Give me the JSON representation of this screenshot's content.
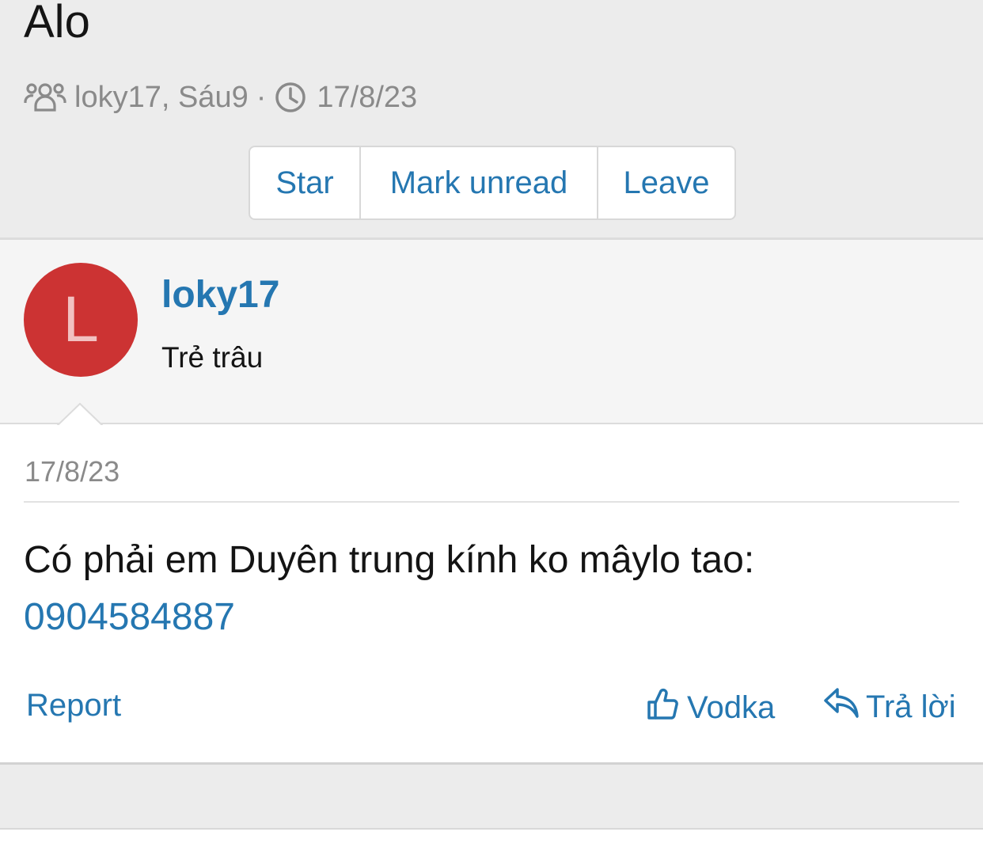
{
  "conversation": {
    "title": "Alo",
    "participants": "loky17, Sáu9",
    "separator": "·",
    "date": "17/8/23"
  },
  "actions": {
    "star_label": "Star",
    "mark_unread_label": "Mark unread",
    "leave_label": "Leave"
  },
  "message": {
    "author": {
      "avatar_letter": "L",
      "avatar_color": "#cc3333",
      "username": "loky17",
      "user_title": "Trẻ trâu"
    },
    "date": "17/8/23",
    "body_text": "Có phải em Duyên trung kính ko mâylo tao:",
    "phone_link": "0904584887",
    "footer": {
      "report_label": "Report",
      "like_label": "Vodka",
      "reply_label": "Trả lời"
    }
  },
  "icons": {
    "participants": "users-icon",
    "date": "clock-icon",
    "like": "thumbs-up-icon",
    "reply": "reply-icon"
  },
  "colors": {
    "link": "#2577b1",
    "muted": "#8a8a8a",
    "background": "#ececec"
  }
}
